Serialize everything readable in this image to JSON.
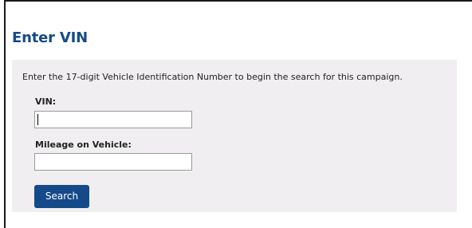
{
  "header": {
    "title": "Enter VIN"
  },
  "form": {
    "instructions": "Enter the 17-digit Vehicle Identification Number to begin the search for this campaign.",
    "vin": {
      "label": "VIN:",
      "value": "",
      "focused": true
    },
    "mileage": {
      "label": "Mileage on Vehicle:",
      "value": ""
    },
    "search_label": "Search"
  },
  "colors": {
    "brand_blue": "#154a8a",
    "panel_background": "#f0eef0",
    "frame_border": "#1a1a1a"
  }
}
